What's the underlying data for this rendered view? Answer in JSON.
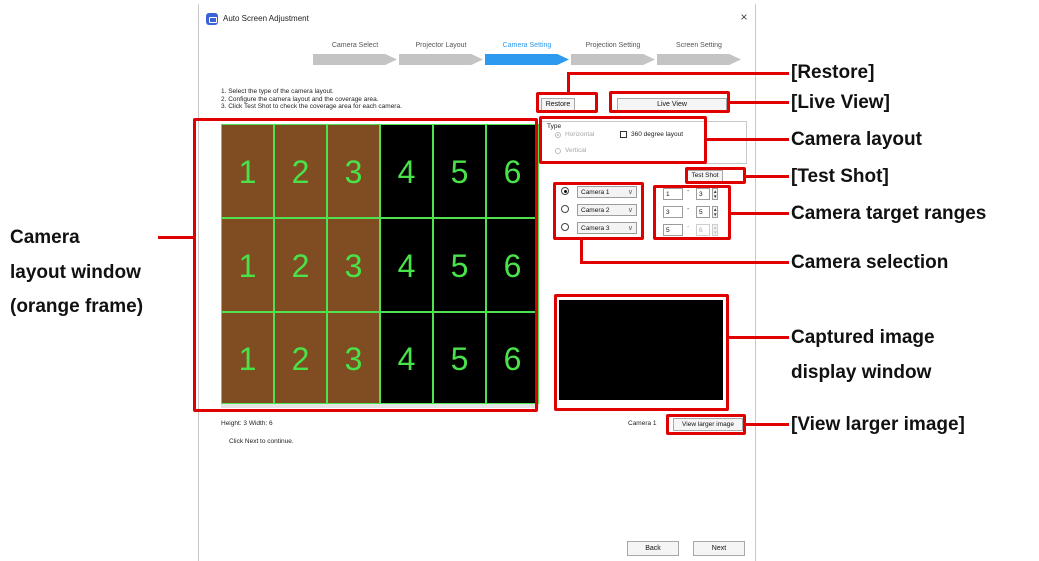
{
  "window": {
    "title": "Auto Screen Adjustment",
    "close_glyph": "×"
  },
  "steps": [
    {
      "label": "Camera Select",
      "active": false
    },
    {
      "label": "Projector Layout",
      "active": false
    },
    {
      "label": "Camera Setting",
      "active": true
    },
    {
      "label": "Projection Setting",
      "active": false
    },
    {
      "label": "Screen Setting",
      "active": false
    }
  ],
  "instructions": [
    "1. Select the type of the camera layout.",
    "2. Configure the camera layout and the coverage area.",
    "3. Click Test Shot to check the coverage area for each camera."
  ],
  "buttons": {
    "restore": "Restore",
    "live_view": "Live View",
    "test_shot": "Test Shot",
    "view_larger": "View larger image",
    "back": "Back",
    "next": "Next"
  },
  "type_group": {
    "label": "Type",
    "horizontal": "Horizontal",
    "vertical": "Vertical",
    "layout_360": "360 degree layout"
  },
  "cameras": [
    {
      "name": "Camera 1",
      "from": "1",
      "to": "3",
      "selected": true
    },
    {
      "name": "Camera 2",
      "from": "3",
      "to": "5",
      "selected": false
    },
    {
      "name": "Camera 3",
      "from": "5",
      "to": "6",
      "selected": false
    }
  ],
  "grid": {
    "rows": [
      [
        "1",
        "2",
        "3",
        "4",
        "5",
        "6"
      ],
      [
        "1",
        "2",
        "3",
        "4",
        "5",
        "6"
      ],
      [
        "1",
        "2",
        "3",
        "4",
        "5",
        "6"
      ]
    ],
    "info": "Height: 3  Width: 6"
  },
  "continue_text": "Click Next to continue.",
  "capture_camera_label": "Camera 1",
  "callouts": {
    "restore": "[Restore]",
    "live_view": "[Live View]",
    "camera_layout": "Camera layout",
    "test_shot": "[Test Shot]",
    "target_ranges": "Camera target ranges",
    "camera_selection": "Camera selection",
    "captured_1": "Captured image",
    "captured_2": "display window",
    "view_larger": "[View larger image]",
    "layout_window_1": "Camera",
    "layout_window_2": "layout window",
    "layout_window_3": "(orange frame)"
  },
  "colors": {
    "accent": "#2d9af0",
    "callout_red": "#e00000",
    "grid_text": "#49e349",
    "orange_cell": "#7f4d21"
  }
}
